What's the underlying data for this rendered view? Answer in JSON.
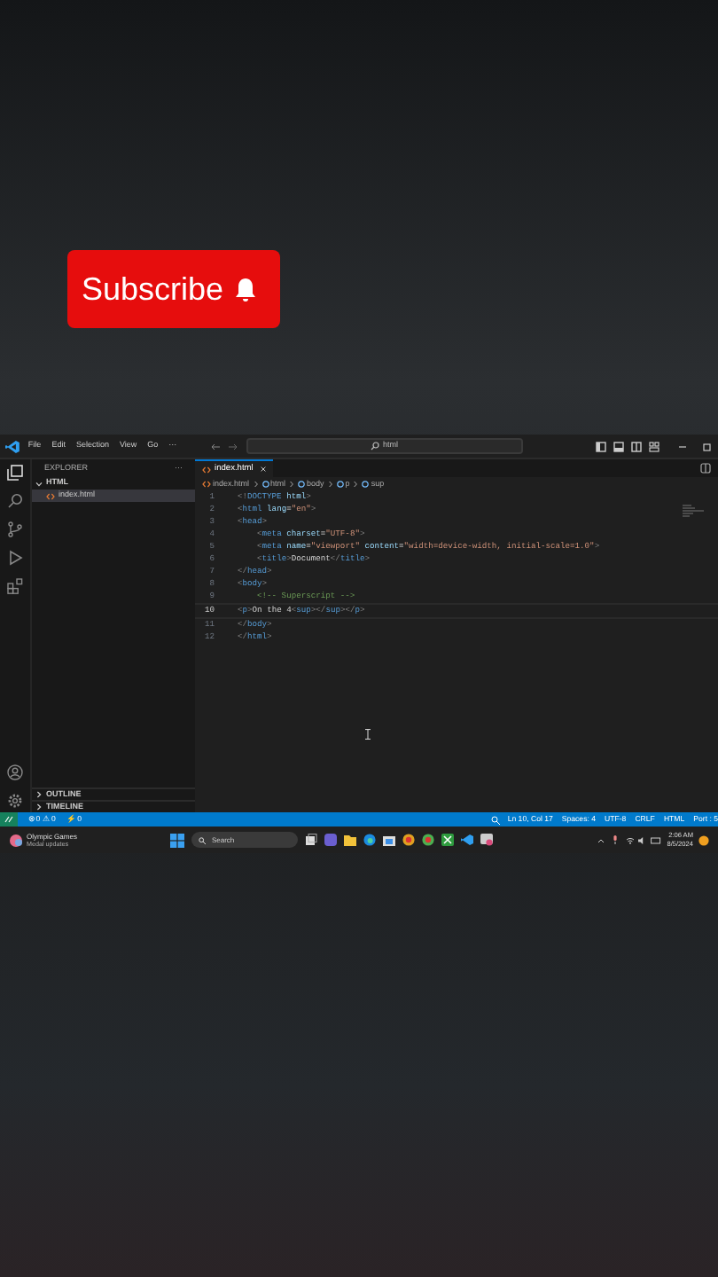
{
  "overlay": {
    "subscribe_label": "Subscribe"
  },
  "menu": [
    "File",
    "Edit",
    "Selection",
    "View",
    "Go",
    "···"
  ],
  "command_center": "html",
  "sidebar": {
    "title": "EXPLORER",
    "more": "···",
    "folder": {
      "label": "HTML",
      "expanded": true,
      "children": [
        {
          "label": "index.html",
          "selected": true
        }
      ]
    },
    "sections": [
      {
        "label": "OUTLINE",
        "expanded": false
      },
      {
        "label": "TIMELINE",
        "expanded": false
      }
    ]
  },
  "tabs": [
    {
      "label": "index.html",
      "selected": true
    }
  ],
  "breadcrumbs": [
    "index.html",
    "html",
    "body",
    "p",
    "sup"
  ],
  "code_lines": [
    {
      "number": "1",
      "current": false,
      "tokens": [
        {
          "kind": "punct",
          "text": "<!"
        },
        {
          "kind": "tag",
          "text": "DOCTYPE"
        },
        {
          "kind": "attr",
          "text": " html"
        },
        {
          "kind": "punct",
          "text": ">"
        }
      ]
    },
    {
      "number": "2",
      "current": false,
      "tokens": [
        {
          "kind": "punct",
          "text": "<"
        },
        {
          "kind": "tag",
          "text": "html"
        },
        {
          "kind": "attr",
          "text": " lang"
        },
        {
          "kind": "text",
          "text": "="
        },
        {
          "kind": "str",
          "text": "\"en\""
        },
        {
          "kind": "punct",
          "text": ">"
        }
      ]
    },
    {
      "number": "3",
      "current": false,
      "tokens": [
        {
          "kind": "punct",
          "text": "<"
        },
        {
          "kind": "tag",
          "text": "head"
        },
        {
          "kind": "punct",
          "text": ">"
        }
      ]
    },
    {
      "number": "4",
      "current": false,
      "tokens": [
        {
          "kind": "punct",
          "text": "    <"
        },
        {
          "kind": "tag",
          "text": "meta"
        },
        {
          "kind": "attr",
          "text": " charset"
        },
        {
          "kind": "text",
          "text": "="
        },
        {
          "kind": "str",
          "text": "\"UTF-8\""
        },
        {
          "kind": "punct",
          "text": ">"
        }
      ]
    },
    {
      "number": "5",
      "current": false,
      "tokens": [
        {
          "kind": "punct",
          "text": "    <"
        },
        {
          "kind": "tag",
          "text": "meta"
        },
        {
          "kind": "attr",
          "text": " name"
        },
        {
          "kind": "text",
          "text": "="
        },
        {
          "kind": "str",
          "text": "\"viewport\""
        },
        {
          "kind": "attr",
          "text": " content"
        },
        {
          "kind": "text",
          "text": "="
        },
        {
          "kind": "str",
          "text": "\"width=device-width, initial-scale=1.0\""
        },
        {
          "kind": "punct",
          "text": ">"
        }
      ]
    },
    {
      "number": "6",
      "current": false,
      "tokens": [
        {
          "kind": "punct",
          "text": "    <"
        },
        {
          "kind": "tag",
          "text": "title"
        },
        {
          "kind": "punct",
          "text": ">"
        },
        {
          "kind": "text",
          "text": "Document"
        },
        {
          "kind": "punct",
          "text": "</"
        },
        {
          "kind": "tag",
          "text": "title"
        },
        {
          "kind": "punct",
          "text": ">"
        }
      ]
    },
    {
      "number": "7",
      "current": false,
      "tokens": [
        {
          "kind": "punct",
          "text": "</"
        },
        {
          "kind": "tag",
          "text": "head"
        },
        {
          "kind": "punct",
          "text": ">"
        }
      ]
    },
    {
      "number": "8",
      "current": false,
      "tokens": [
        {
          "kind": "punct",
          "text": "<"
        },
        {
          "kind": "tag",
          "text": "body"
        },
        {
          "kind": "punct",
          "text": ">"
        }
      ]
    },
    {
      "number": "9",
      "current": false,
      "tokens": [
        {
          "kind": "comment",
          "text": "    <!-- Superscript -->"
        }
      ]
    },
    {
      "number": "10",
      "current": true,
      "tokens": [
        {
          "kind": "punct",
          "text": "<"
        },
        {
          "kind": "tag",
          "text": "p"
        },
        {
          "kind": "punct",
          "text": ">"
        },
        {
          "kind": "text",
          "text": "On the 4"
        },
        {
          "kind": "punct",
          "text": "<"
        },
        {
          "kind": "tag",
          "text": "sup"
        },
        {
          "kind": "punct",
          "text": "></"
        },
        {
          "kind": "tag",
          "text": "sup"
        },
        {
          "kind": "punct",
          "text": "></"
        },
        {
          "kind": "tag",
          "text": "p"
        },
        {
          "kind": "punct",
          "text": ">"
        }
      ]
    },
    {
      "number": "11",
      "current": false,
      "tokens": [
        {
          "kind": "punct",
          "text": "</"
        },
        {
          "kind": "tag",
          "text": "body"
        },
        {
          "kind": "punct",
          "text": ">"
        }
      ]
    },
    {
      "number": "12",
      "current": false,
      "tokens": [
        {
          "kind": "punct",
          "text": "</"
        },
        {
          "kind": "tag",
          "text": "html"
        },
        {
          "kind": "punct",
          "text": ">"
        }
      ]
    }
  ],
  "status_bar": {
    "problems": "⊗ 0 ⚠ 0",
    "ports": "⚡ 0",
    "right": [
      "Ln 10, Col 17",
      "Spaces: 4",
      "UTF-8",
      "CRLF",
      "HTML",
      "Port : 5"
    ]
  },
  "taskbar": {
    "news_title": "Olympic Games",
    "news_subtitle": "Medal updates",
    "search": "Search",
    "time": "2:06 AM",
    "date": "8/5/2024"
  }
}
